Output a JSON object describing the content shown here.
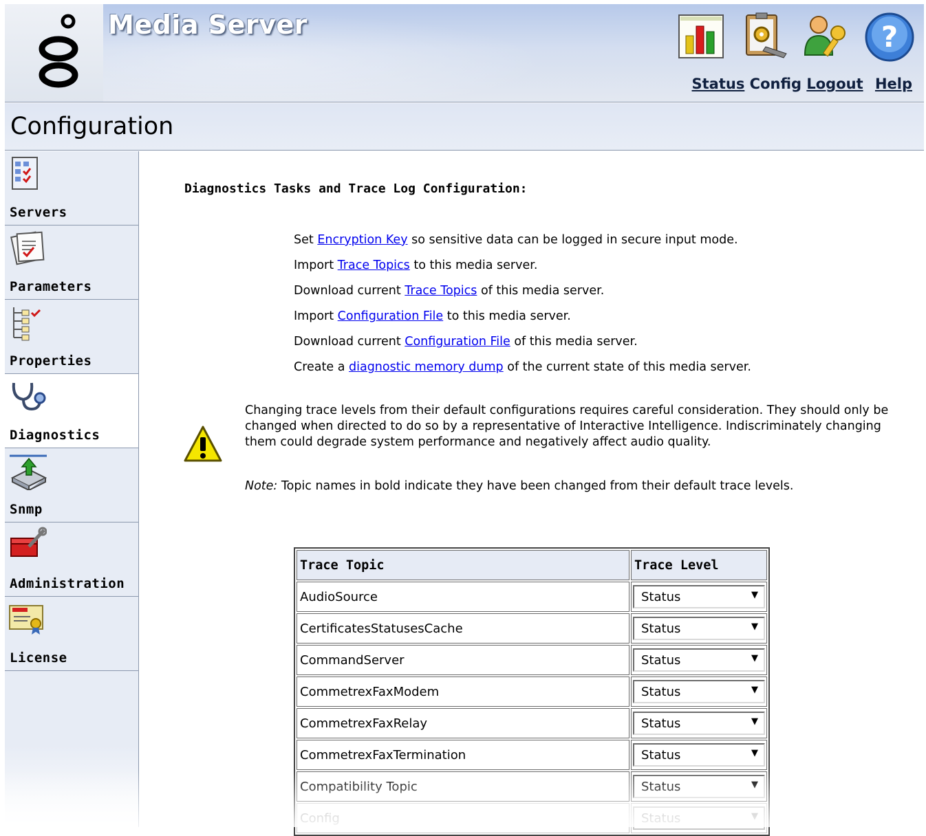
{
  "header": {
    "app_title": "Media Server",
    "logo_icon": "genesys-logo-icon",
    "toolbar_icons": [
      "status-chart-icon",
      "config-clipboard-icon",
      "logout-user-key-icon",
      "help-icon"
    ],
    "links": {
      "status": "Status",
      "config": "Config",
      "logout": "Logout",
      "help": "Help"
    }
  },
  "page": {
    "title": "Configuration"
  },
  "sidebar": {
    "items": [
      {
        "label": "Servers",
        "icon": "checklist-icon"
      },
      {
        "label": "Parameters",
        "icon": "parameters-clipboard-icon"
      },
      {
        "label": "Properties",
        "icon": "tree-properties-icon"
      },
      {
        "label": "Diagnostics",
        "icon": "stethoscope-icon",
        "active": true
      },
      {
        "label": "Snmp",
        "icon": "snmp-device-icon"
      },
      {
        "label": "Administration",
        "icon": "toolbox-icon"
      },
      {
        "label": "License",
        "icon": "certificate-icon"
      }
    ]
  },
  "main": {
    "heading": "Diagnostics Tasks and Trace Log Configuration:",
    "tasks": [
      {
        "before": "Set ",
        "link": "Encryption Key",
        "after": " so sensitive data can be logged in secure input mode."
      },
      {
        "before": "Import ",
        "link": "Trace Topics",
        "after": " to this media server."
      },
      {
        "before": "Download current ",
        "link": "Trace Topics",
        "after": " of this media server."
      },
      {
        "before": "Import ",
        "link": "Configuration File",
        "after": " to this media server."
      },
      {
        "before": "Download current ",
        "link": "Configuration File",
        "after": " of this media server."
      },
      {
        "before": "Create a ",
        "link": "diagnostic memory dump",
        "after": " of the current state of this media server."
      }
    ],
    "warning": "Changing trace levels from their default configurations requires careful consideration. They should only be changed when directed to do so by a representative of Interactive Intelligence. Indiscriminately changing them could degrade system performance and negatively affect audio quality.",
    "note_label": "Note:",
    "note": " Topic names in bold indicate they have been changed from their default trace levels."
  },
  "table": {
    "headers": {
      "topic": "Trace Topic",
      "level": "Trace Level"
    },
    "rows": [
      {
        "topic": "AudioSource",
        "level": "Status"
      },
      {
        "topic": "CertificatesStatusesCache",
        "level": "Status"
      },
      {
        "topic": "CommandServer",
        "level": "Status"
      },
      {
        "topic": "CommetrexFaxModem",
        "level": "Status"
      },
      {
        "topic": "CommetrexFaxRelay",
        "level": "Status"
      },
      {
        "topic": "CommetrexFaxTermination",
        "level": "Status"
      },
      {
        "topic": "Compatibility Topic",
        "level": "Status"
      },
      {
        "topic": "Config",
        "level": "Status"
      }
    ]
  }
}
